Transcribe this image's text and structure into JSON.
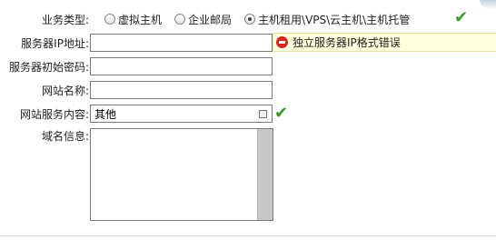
{
  "form": {
    "business_type": {
      "label": "业务类型:",
      "options": [
        {
          "label": "虚拟主机",
          "checked": false
        },
        {
          "label": "企业邮局",
          "checked": false
        },
        {
          "label": "主机租用\\VPS\\云主机\\主机托管",
          "checked": true
        }
      ]
    },
    "server_ip": {
      "label": "服务器IP地址:",
      "value": "",
      "error": "独立服务器IP格式错误"
    },
    "server_password": {
      "label": "服务器初始密码:",
      "value": ""
    },
    "site_name": {
      "label": "网站名称:",
      "value": ""
    },
    "site_content": {
      "label": "网站服务内容:",
      "value": "其他"
    },
    "domain_info": {
      "label": "域名信息:",
      "value": ""
    }
  },
  "colors": {
    "valid": "#3a9a2a",
    "error_bg": "#ffffdd",
    "error_icon": "#d8261e"
  },
  "icons": [
    "check-icon",
    "error-icon",
    "select-arrow-icon"
  ]
}
